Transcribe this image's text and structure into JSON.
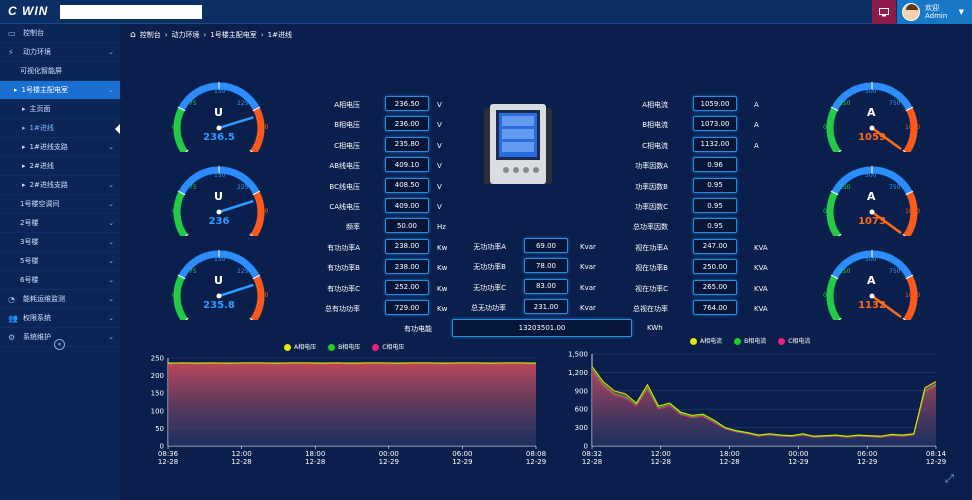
{
  "app": {
    "logo_text": "C WIN"
  },
  "user": {
    "line1": "欢迎",
    "line2": "Admin"
  },
  "sidebar": {
    "items": [
      {
        "label": "控制台",
        "icon": "dashboard-icon"
      },
      {
        "label": "动力环境",
        "icon": "bolt-icon"
      },
      {
        "label": "可视化智能屏"
      },
      {
        "label": "1号楼主配电室"
      },
      {
        "label": "主页面"
      },
      {
        "label": "1#进线"
      },
      {
        "label": "1#进线支路"
      },
      {
        "label": "2#进线"
      },
      {
        "label": "2#进线支路"
      },
      {
        "label": "1号楼空调间"
      },
      {
        "label": "2号楼"
      },
      {
        "label": "3号楼"
      },
      {
        "label": "5号楼"
      },
      {
        "label": "6号楼"
      },
      {
        "label": "能耗运维监测",
        "icon": "pie-chart-icon"
      },
      {
        "label": "权限系统",
        "icon": "users-icon"
      },
      {
        "label": "系统维护",
        "icon": "gear-icon"
      }
    ]
  },
  "breadcrumb": [
    "控制台",
    "动力环境",
    "1号楼主配电室",
    "1#进线"
  ],
  "gauges_voltage": [
    {
      "letter": "U",
      "value": "236.5",
      "ticks": [
        "0",
        "75",
        "150",
        "225",
        "300"
      ]
    },
    {
      "letter": "U",
      "value": "236",
      "ticks": [
        "0",
        "75",
        "150",
        "225",
        "300"
      ]
    },
    {
      "letter": "U",
      "value": "235.8",
      "ticks": [
        "0",
        "75",
        "150",
        "225",
        "300"
      ]
    }
  ],
  "gauges_current": [
    {
      "letter": "A",
      "value": "1059",
      "ticks": [
        "0",
        "250",
        "500",
        "750",
        "1000"
      ]
    },
    {
      "letter": "A",
      "value": "1073",
      "ticks": [
        "0",
        "250",
        "500",
        "750",
        "1000"
      ]
    },
    {
      "letter": "A",
      "value": "1132",
      "ticks": [
        "0",
        "250",
        "500",
        "750",
        "1000"
      ]
    }
  ],
  "left_params": [
    {
      "label": "A相电压",
      "value": "236.50",
      "unit": "V"
    },
    {
      "label": "B相电压",
      "value": "236.00",
      "unit": "V"
    },
    {
      "label": "C相电压",
      "value": "235.80",
      "unit": "V"
    },
    {
      "label": "AB线电压",
      "value": "409.10",
      "unit": "V"
    },
    {
      "label": "BC线电压",
      "value": "408.50",
      "unit": "V"
    },
    {
      "label": "CA线电压",
      "value": "409.00",
      "unit": "V"
    },
    {
      "label": "频率",
      "value": "50.00",
      "unit": "Hz"
    },
    {
      "label": "有功功率A",
      "value": "238.00",
      "unit": "Kw"
    },
    {
      "label": "有功功率B",
      "value": "238.00",
      "unit": "Kw"
    },
    {
      "label": "有功功率C",
      "value": "252.00",
      "unit": "Kw"
    },
    {
      "label": "总有功功率",
      "value": "729.00",
      "unit": "Kw"
    }
  ],
  "mid_params": [
    {
      "label": "无功功率A",
      "value": "69.00",
      "unit": "Kvar"
    },
    {
      "label": "无功功率B",
      "value": "78.00",
      "unit": "Kvar"
    },
    {
      "label": "无功功率C",
      "value": "83.00",
      "unit": "Kvar"
    },
    {
      "label": "总无功功率",
      "value": "231.00",
      "unit": "Kvar"
    }
  ],
  "right_params": [
    {
      "label": "A相电流",
      "value": "1059.00",
      "unit": "A"
    },
    {
      "label": "B相电流",
      "value": "1073.00",
      "unit": "A"
    },
    {
      "label": "C相电流",
      "value": "1132.00",
      "unit": "A"
    },
    {
      "label": "功率因数A",
      "value": "0.96",
      "unit": ""
    },
    {
      "label": "功率因数B",
      "value": "0.95",
      "unit": ""
    },
    {
      "label": "功率因数C",
      "value": "0.95",
      "unit": ""
    },
    {
      "label": "总功率因数",
      "value": "0.95",
      "unit": ""
    },
    {
      "label": "视在功率A",
      "value": "247.00",
      "unit": "KVA"
    },
    {
      "label": "视在功率B",
      "value": "250.00",
      "unit": "KVA"
    },
    {
      "label": "视在功率C",
      "value": "265.00",
      "unit": "KVA"
    },
    {
      "label": "总视在功率",
      "value": "764.00",
      "unit": "KVA"
    }
  ],
  "energy": {
    "label": "有功电能",
    "value": "13203501.00",
    "unit": "KWh"
  },
  "colors": {
    "phaseA": "#e8e800",
    "phaseB": "#22cc22",
    "phaseC": "#ee2277",
    "voltage_value": "#2d9bff",
    "current_value": "#ff6a1a"
  },
  "chart_data": [
    {
      "type": "area",
      "series": [
        {
          "name": "A相电压",
          "values": [
            235,
            236,
            235,
            236,
            235,
            236,
            236,
            235,
            236,
            236,
            235,
            236,
            235,
            236,
            236,
            235,
            236,
            236,
            235,
            236,
            236,
            235,
            236,
            236,
            235
          ]
        },
        {
          "name": "B相电压",
          "values": [
            236,
            236,
            236,
            236,
            236,
            236,
            236,
            236,
            236,
            236,
            236,
            236,
            236,
            236,
            236,
            236,
            236,
            236,
            236,
            236,
            236,
            236,
            236,
            236,
            236
          ]
        },
        {
          "name": "C相电压",
          "values": [
            236,
            235,
            236,
            235,
            236,
            235,
            235,
            236,
            235,
            235,
            236,
            235,
            236,
            235,
            235,
            236,
            235,
            235,
            236,
            235,
            235,
            236,
            235,
            235,
            236
          ]
        }
      ],
      "yticks": [
        "0",
        "50",
        "100",
        "150",
        "200",
        "250"
      ],
      "ylim": [
        0,
        250
      ],
      "xticks": [
        [
          "08:36",
          "12-28"
        ],
        [
          "12:00",
          "12-28"
        ],
        [
          "18:00",
          "12-28"
        ],
        [
          "00:00",
          "12-29"
        ],
        [
          "06:00",
          "12-29"
        ],
        [
          "08:08",
          "12-29"
        ]
      ]
    },
    {
      "type": "area",
      "series": [
        {
          "name": "A相电流",
          "values": [
            1300,
            1050,
            900,
            850,
            700,
            1000,
            650,
            700,
            550,
            500,
            520,
            420,
            300,
            250,
            220,
            180,
            200,
            180,
            170,
            200,
            160,
            170,
            180,
            160,
            180,
            170,
            160,
            190,
            180,
            200,
            950,
            1050
          ]
        },
        {
          "name": "B相电流",
          "values": [
            1250,
            1000,
            850,
            800,
            680,
            950,
            620,
            680,
            530,
            480,
            500,
            400,
            290,
            240,
            210,
            170,
            190,
            170,
            160,
            190,
            150,
            160,
            170,
            150,
            170,
            160,
            150,
            180,
            170,
            190,
            900,
            1000
          ]
        },
        {
          "name": "C相电流",
          "values": [
            1200,
            980,
            820,
            780,
            650,
            920,
            600,
            650,
            510,
            460,
            480,
            380,
            280,
            230,
            200,
            160,
            180,
            160,
            150,
            180,
            140,
            150,
            160,
            140,
            160,
            150,
            140,
            170,
            160,
            180,
            880,
            980
          ]
        }
      ],
      "yticks": [
        "0",
        "300",
        "600",
        "900",
        "1,200",
        "1,500"
      ],
      "ylim": [
        0,
        1500
      ],
      "xticks": [
        [
          "08:32",
          "12-28"
        ],
        [
          "12:00",
          "12-28"
        ],
        [
          "18:00",
          "12-28"
        ],
        [
          "00:00",
          "12-29"
        ],
        [
          "06:00",
          "12-29"
        ],
        [
          "08:14",
          "12-29"
        ]
      ]
    }
  ]
}
